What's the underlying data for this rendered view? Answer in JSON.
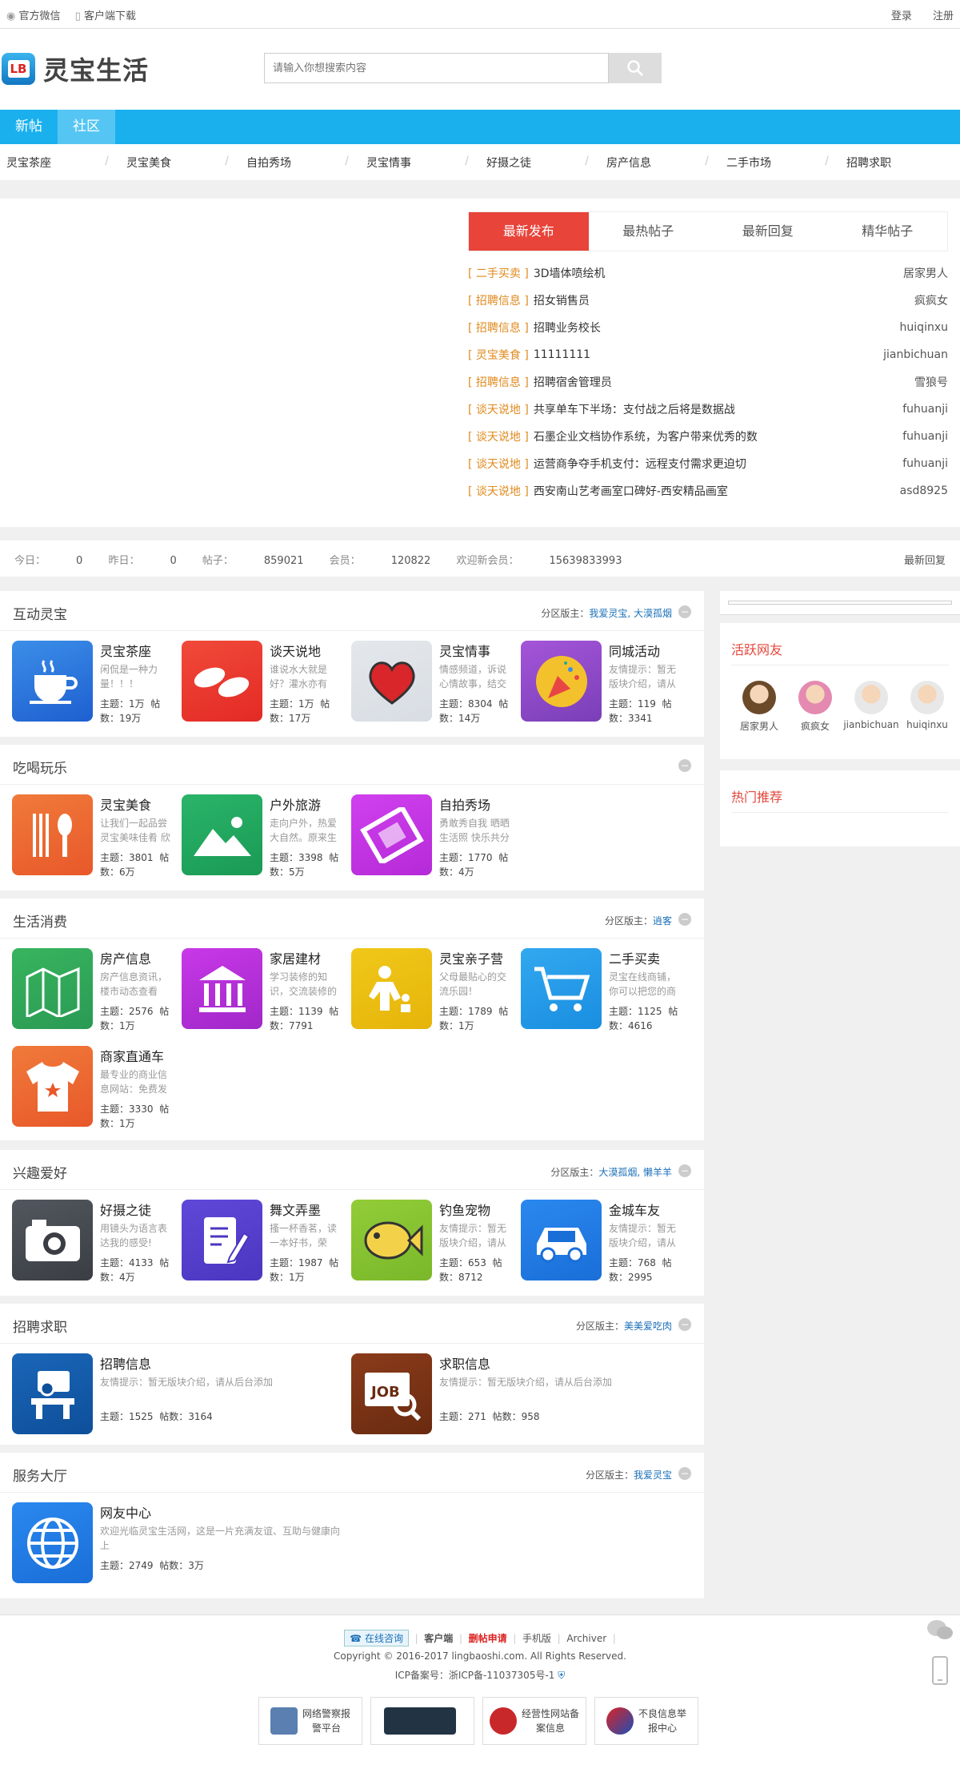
{
  "topbar": {
    "wechat": "官方微信",
    "client": "客户端下载",
    "login": "登录",
    "register": "注册"
  },
  "header": {
    "logo_badge": "LB",
    "logo_text": "灵宝生活",
    "search_placeholder": "请输入你想搜索内容"
  },
  "nav": [
    "新帖",
    "社区"
  ],
  "subnav": [
    "灵宝茶座",
    "灵宝美食",
    "自拍秀场",
    "灵宝情事",
    "好摄之徒",
    "房产信息",
    "二手市场",
    "招聘求职"
  ],
  "latest": {
    "tabs": [
      "最新发布",
      "最热帖子",
      "最新回复",
      "精华帖子"
    ],
    "rows": [
      {
        "cat": "[ 二手买卖 ]",
        "title": "3D墙体喷绘机",
        "user": "居家男人"
      },
      {
        "cat": "[ 招聘信息 ]",
        "title": "招女销售员",
        "user": "疯疯女"
      },
      {
        "cat": "[ 招聘信息 ]",
        "title": "招聘业务校长",
        "user": "huiqinxu"
      },
      {
        "cat": "[ 灵宝美食 ]",
        "title": "11111111",
        "user": "jianbichuan"
      },
      {
        "cat": "[ 招聘信息 ]",
        "title": "招聘宿舍管理员",
        "user": "雪狼号"
      },
      {
        "cat": "[ 谈天说地 ]",
        "title": "共享单车下半场：支付战之后将是数据战",
        "user": "fuhuanji"
      },
      {
        "cat": "[ 谈天说地 ]",
        "title": "石墨企业文档协作系统，为客户带来优秀的数",
        "user": "fuhuanji"
      },
      {
        "cat": "[ 谈天说地 ]",
        "title": "运营商争夺手机支付：远程支付需求更迫切",
        "user": "fuhuanji"
      },
      {
        "cat": "[ 谈天说地 ]",
        "title": "西安南山艺考画室口碑好-西安精品画室",
        "user": "asd8925"
      }
    ]
  },
  "stats": {
    "today_label": "今日：",
    "today": "0",
    "yesterday_label": "昨日：",
    "yesterday": "0",
    "posts_label": "帖子：",
    "posts": "859021",
    "members_label": "会员：",
    "members": "120822",
    "welcome_label": "欢迎新会员：",
    "welcome": "15639833993",
    "latest_reply": "最新回复"
  },
  "sections": [
    {
      "title": "互动灵宝",
      "mod_label": "分区版主：",
      "mods": "我爱灵宝, 大漠孤烟",
      "forums": [
        {
          "name": "灵宝茶座",
          "desc": "闲侃是一种力量！！！",
          "topics": "1万",
          "posts": "19万"
        },
        {
          "name": "谈天说地",
          "desc": "谁说水大就是好？灌水亦有",
          "topics": "1万",
          "posts": "17万"
        },
        {
          "name": "灵宝情事",
          "desc": "情感频道，诉说心情故事，结交",
          "topics": "8304",
          "posts": "14万"
        },
        {
          "name": "同城活动",
          "desc": "友情提示：暂无版块介绍，请从",
          "topics": "119",
          "posts": "3341"
        }
      ]
    },
    {
      "title": "吃喝玩乐",
      "mod_label": "",
      "mods": "",
      "forums": [
        {
          "name": "灵宝美食",
          "desc": "让我们一起品尝灵宝美味佳肴 欣",
          "topics": "3801",
          "posts": "6万"
        },
        {
          "name": "户外旅游",
          "desc": "走向户外，热爱大自然。原来生",
          "topics": "3398",
          "posts": "5万"
        },
        {
          "name": "自拍秀场",
          "desc": "勇敢秀自我 晒晒生活照 快乐共分",
          "topics": "1770",
          "posts": "4万"
        }
      ]
    },
    {
      "title": "生活消费",
      "mod_label": "分区版主：",
      "mods": "逍客",
      "forums": [
        {
          "name": "房产信息",
          "desc": "房产信息资讯，楼市动态查看",
          "topics": "2576",
          "posts": "1万"
        },
        {
          "name": "家居建材",
          "desc": "学习装修的知识，交流装修的",
          "topics": "1139",
          "posts": "7791"
        },
        {
          "name": "灵宝亲子营",
          "desc": "父母最贴心的交流乐园！",
          "topics": "1789",
          "posts": "1万"
        },
        {
          "name": "二手买卖",
          "desc": "灵宝在线商铺，你可以把您的商",
          "topics": "1125",
          "posts": "4616"
        },
        {
          "name": "商家直通车",
          "desc": "最专业的商业信息网站：免费发",
          "topics": "3330",
          "posts": "1万"
        }
      ]
    },
    {
      "title": "兴趣爱好",
      "mod_label": "分区版主：",
      "mods": "大漠孤烟, 懒羊羊",
      "forums": [
        {
          "name": "好摄之徒",
          "desc": "用镜头为语言表达我的感受!",
          "topics": "4133",
          "posts": "4万"
        },
        {
          "name": "舞文弄墨",
          "desc": "搔一杯香茗，读一本好书，荣",
          "topics": "1987",
          "posts": "1万"
        },
        {
          "name": "钓鱼宠物",
          "desc": "友情提示：暂无版块介绍，请从",
          "topics": "653",
          "posts": "8712"
        },
        {
          "name": "金城车友",
          "desc": "友情提示：暂无版块介绍，请从",
          "topics": "768",
          "posts": "2995"
        }
      ]
    },
    {
      "title": "招聘求职",
      "mod_label": "分区版主：",
      "mods": "美美爱吃肉",
      "forums": [
        {
          "name": "招聘信息",
          "desc": "友情提示：暂无版块介绍，请从后台添加",
          "topics": "1525",
          "posts": "3164"
        },
        {
          "name": "求职信息",
          "desc": "友情提示：暂无版块介绍，请从后台添加",
          "topics": "271",
          "posts": "958"
        }
      ]
    },
    {
      "title": "服务大厅",
      "mod_label": "分区版主：",
      "mods": "我爱灵宝",
      "forums": [
        {
          "name": "网友中心",
          "desc": "欢迎光临灵宝生活网，这是一片充满友谊、互助与健康向上",
          "topics": "2749",
          "posts": "3万"
        }
      ]
    }
  ],
  "labels": {
    "topics": "主题：",
    "posts": "帖数：",
    "toggle": "−"
  },
  "side": {
    "active_title": "活跃网友",
    "active_users": [
      "居家男人",
      "疯疯女",
      "jianbichuan",
      "huiqinxu"
    ],
    "hot_title": "热门推荐"
  },
  "footer": {
    "online": "在线咨询",
    "client": "客户端",
    "hot": "删帖申请",
    "mobile": "手机版",
    "archiver": "Archiver",
    "sep": "|",
    "copyright": "Copyright © 2016-2017 lingbaoshi.com. All Rights Reserved.",
    "icp": "ICP备案号：浙ICP备-11037305号-1",
    "badges": [
      {
        "l1": "网络警察报",
        "l2": "警平台"
      },
      {
        "l1": "",
        "l2": ""
      },
      {
        "l1": "经营性网站备",
        "l2": "案信息"
      },
      {
        "l1": "不良信息举",
        "l2": "报中心"
      }
    ]
  },
  "colors": {
    "accent": "#1ab0ee",
    "red": "#e8443a",
    "orange": "#e08a1e"
  }
}
